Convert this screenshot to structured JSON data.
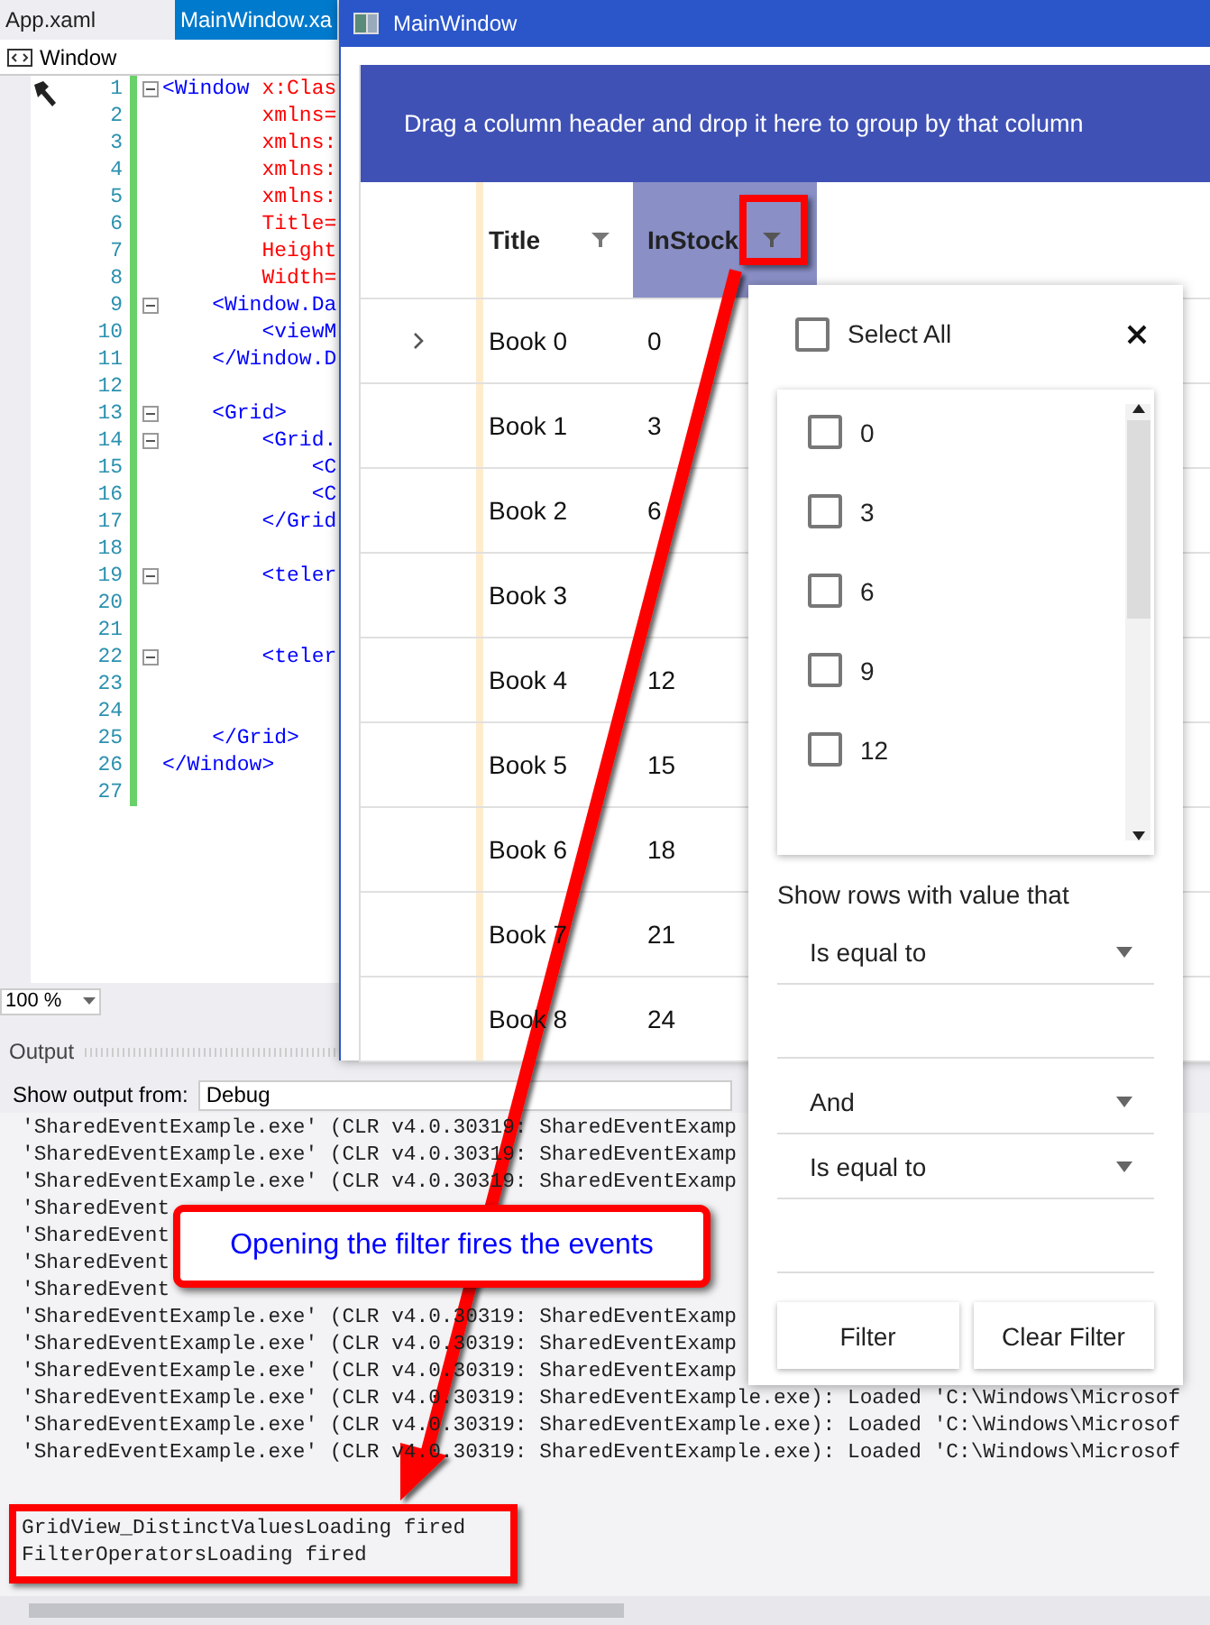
{
  "ide": {
    "tabs": [
      {
        "label": "App.xaml",
        "selected": false
      },
      {
        "label": "MainWindow.xa",
        "selected": true
      }
    ],
    "nav_label": "Window",
    "code_lines": [
      {
        "number": "1",
        "fold": true,
        "tag": "<Window",
        "attr": " x:Clas"
      },
      {
        "number": "2",
        "fold": false,
        "attr": "        xmlns="
      },
      {
        "number": "3",
        "fold": false,
        "attr": "        xmlns:"
      },
      {
        "number": "4",
        "fold": false,
        "attr": "        xmlns:"
      },
      {
        "number": "5",
        "fold": false,
        "attr": "        xmlns:"
      },
      {
        "number": "6",
        "fold": false,
        "attr": "        Title="
      },
      {
        "number": "7",
        "fold": false,
        "attr": "        Height"
      },
      {
        "number": "8",
        "fold": false,
        "attr": "        Width="
      },
      {
        "number": "9",
        "fold": true,
        "tag": "    <Window.Da"
      },
      {
        "number": "10",
        "fold": false,
        "tag": "        <viewM"
      },
      {
        "number": "11",
        "fold": false,
        "tag": "    </Window.D"
      },
      {
        "number": "12",
        "fold": false
      },
      {
        "number": "13",
        "fold": true,
        "tag": "    <Grid>"
      },
      {
        "number": "14",
        "fold": true,
        "tag": "        <Grid."
      },
      {
        "number": "15",
        "fold": false,
        "tag": "            <C"
      },
      {
        "number": "16",
        "fold": false,
        "tag": "            <C"
      },
      {
        "number": "17",
        "fold": false,
        "tag": "        </Grid"
      },
      {
        "number": "18",
        "fold": false
      },
      {
        "number": "19",
        "fold": true,
        "tag": "        <teler"
      },
      {
        "number": "20",
        "fold": false
      },
      {
        "number": "21",
        "fold": false
      },
      {
        "number": "22",
        "fold": true,
        "tag": "        <teler"
      },
      {
        "number": "23",
        "fold": false
      },
      {
        "number": "24",
        "fold": false
      },
      {
        "number": "25",
        "fold": false,
        "tag": "    </Grid>"
      },
      {
        "number": "26",
        "fold": false,
        "tag": "</Window>"
      },
      {
        "number": "27",
        "fold": false
      }
    ],
    "zoom": "100 %",
    "output": {
      "title": "Output",
      "source_label": "Show output from:",
      "source_value": "Debug",
      "lines": [
        "'SharedEventExample.exe' (CLR v4.0.30319: SharedEventExamp",
        "'SharedEventExample.exe' (CLR v4.0.30319: SharedEventExamp",
        "'SharedEventExample.exe' (CLR v4.0.30319: SharedEventExamp",
        "'SharedEvent",
        "'SharedEvent",
        "'SharedEvent",
        "'SharedEvent",
        "'SharedEventExample.exe' (CLR v4.0.30319: SharedEventExamp",
        "'SharedEventExample.exe' (CLR v4.0.30319: SharedEventExamp",
        "'SharedEventExample.exe' (CLR v4.0.30319: SharedEventExamp",
        "'SharedEventExample.exe' (CLR v4.0.30319: SharedEventExample.exe): Loaded 'C:\\Windows\\Microsof",
        "'SharedEventExample.exe' (CLR v4.0.30319: SharedEventExample.exe): Loaded 'C:\\Windows\\Microsof",
        "'SharedEventExample.exe' (CLR v4.0.30319: SharedEventExample.exe): Loaded 'C:\\Windows\\Microsof"
      ],
      "highlighted_lines": [
        "GridView_DistinctValuesLoading fired",
        "FilterOperatorsLoading fired"
      ]
    }
  },
  "main_window": {
    "title": "MainWindow",
    "group_panel": "Drag a column header and drop it here to group by that column",
    "columns": [
      {
        "label": "Title",
        "filtered": false
      },
      {
        "label": "InStock",
        "filtered": true
      }
    ],
    "rows": [
      {
        "title": "Book 0",
        "in_stock": "0",
        "expandable": true
      },
      {
        "title": "Book 1",
        "in_stock": "3",
        "expandable": false
      },
      {
        "title": "Book 2",
        "in_stock": "6",
        "expandable": false
      },
      {
        "title": "Book 3",
        "expandable": false
      },
      {
        "title": "Book 4",
        "in_stock": "12",
        "expandable": false
      },
      {
        "title": "Book 5",
        "in_stock": "15",
        "expandable": false
      },
      {
        "title": "Book 6",
        "in_stock": "18",
        "expandable": false
      },
      {
        "title": "Book 7",
        "in_stock": "21",
        "expandable": false
      },
      {
        "title": "Book 8",
        "in_stock": "24",
        "expandable": false
      }
    ]
  },
  "filter_popup": {
    "select_all": {
      "label": "Select All",
      "checked": false
    },
    "values": [
      {
        "label": "0",
        "checked": false
      },
      {
        "label": "3",
        "checked": false
      },
      {
        "label": "6",
        "checked": false
      },
      {
        "label": "9",
        "checked": false
      },
      {
        "label": "12",
        "checked": false
      }
    ],
    "prompt": "Show rows with value that",
    "operator_1": "Is equal to",
    "logical": "And",
    "operator_2": "Is equal to",
    "buttons": [
      "Filter",
      "Clear Filter"
    ]
  },
  "callout": "Opening the filter fires the events"
}
